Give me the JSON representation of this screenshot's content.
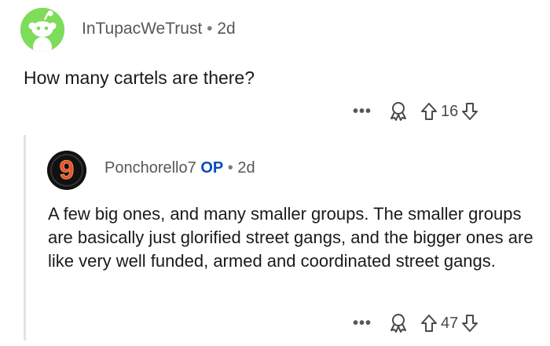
{
  "parent_comment": {
    "username": "InTupacWeTrust",
    "separator": "•",
    "time": "2d",
    "body": "How many cartels are there?",
    "actions": {
      "more_label": "•••",
      "score": "16",
      "award_icon": "award-icon",
      "upvote_icon": "upvote-arrow-icon",
      "downvote_icon": "downvote-arrow-icon"
    }
  },
  "reply_comment": {
    "username": "Ponchorello7",
    "op_badge": "OP",
    "separator": "•",
    "time": "2d",
    "avatar_text": "9",
    "body": "A few big ones, and many smaller groups. The smaller groups are basically just glorified street gangs, and the bigger ones are like very well funded, armed and coordinated street gangs.",
    "actions": {
      "more_label": "•••",
      "score": "47",
      "award_icon": "award-icon",
      "upvote_icon": "upvote-arrow-icon",
      "downvote_icon": "downvote-arrow-icon"
    }
  },
  "colors": {
    "parent_avatar_bg": "#7ddc5a",
    "op_badge": "#0a4bbf",
    "reply_avatar_bg": "#111111",
    "reply_avatar_ring": "#e8552a"
  }
}
